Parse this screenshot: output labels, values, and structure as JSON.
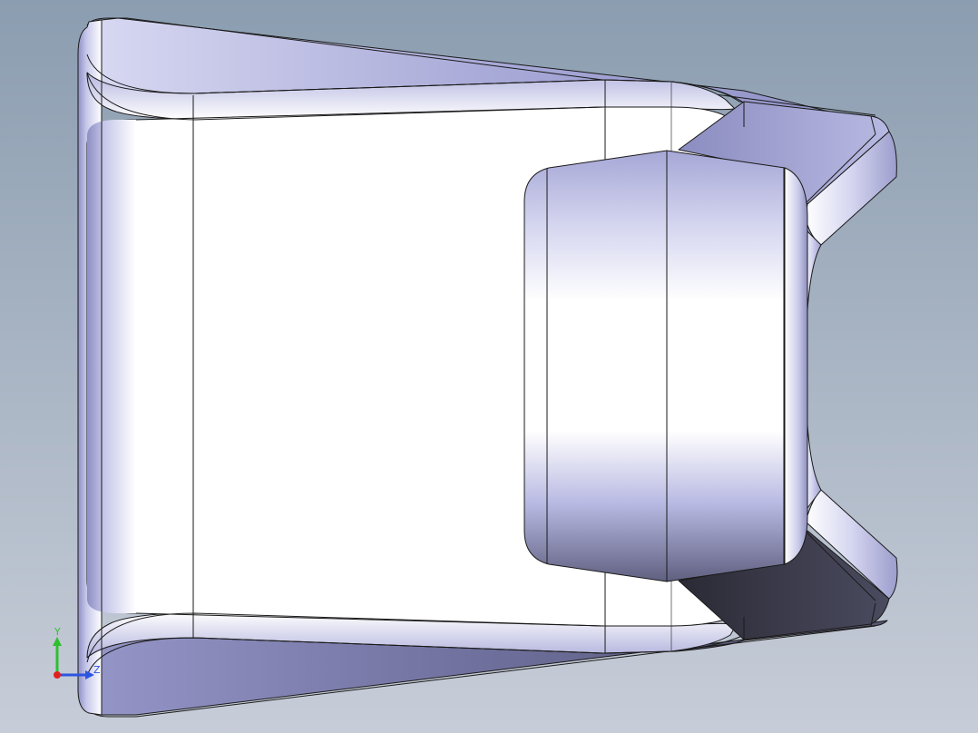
{
  "viewport": {
    "background_top": "#8b9db0",
    "background_bottom": "#c7cdd8",
    "model_shade": "#9a9ccf",
    "model_highlight": "#ffffff",
    "edge_color": "#1a1a1a"
  },
  "triad": {
    "y_label": "Y",
    "z_label": "Z",
    "y_color": "#2fbf2f",
    "z_color": "#2a55e0",
    "x_color": "#e02020"
  }
}
